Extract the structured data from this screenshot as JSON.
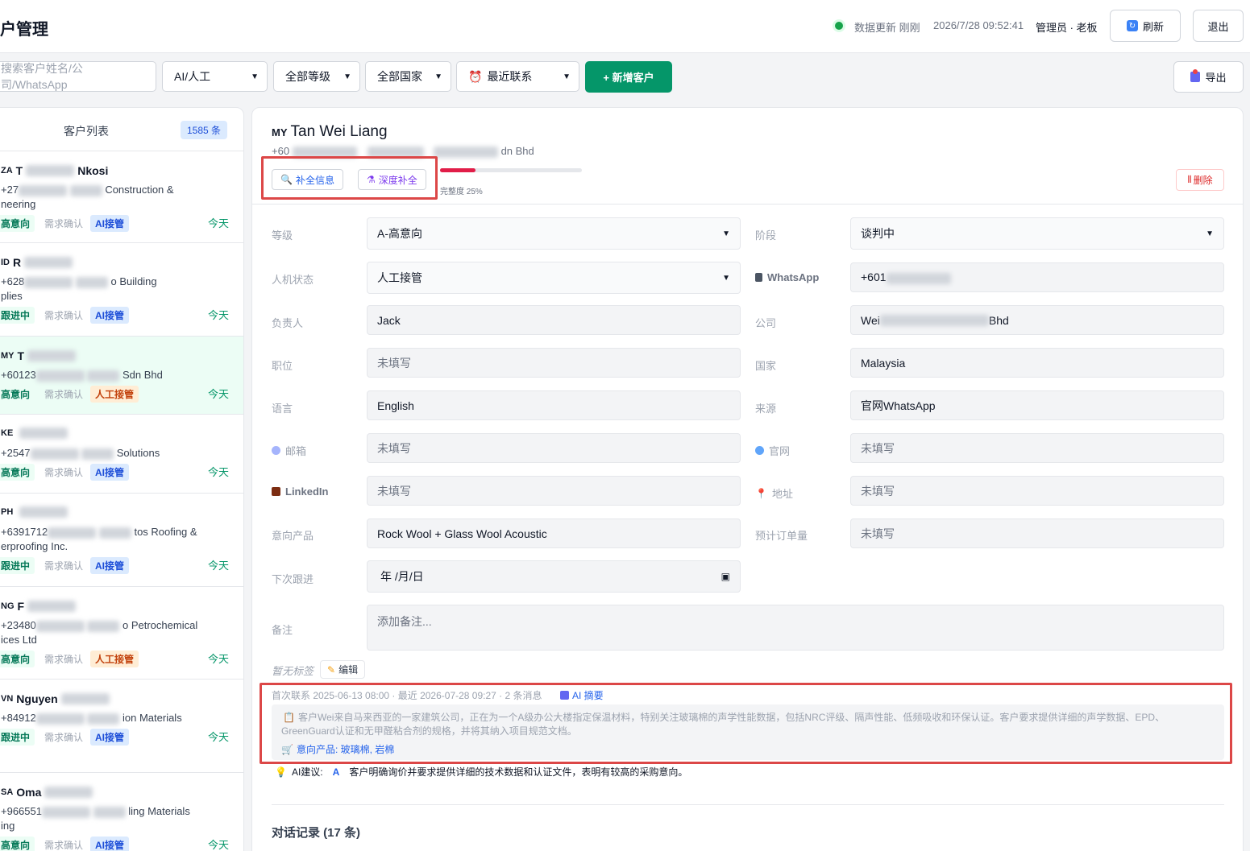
{
  "header": {
    "title": "户管理",
    "status_text": "数据更新 刚刚",
    "timestamp": "2026/7/28 09:52:41",
    "user": "管理员 · 老板",
    "refresh_label": "刷新",
    "logout_label": "退出"
  },
  "filters": {
    "search_placeholder": "搜索客户姓名/公司/WhatsApp",
    "ai_human": "AI/人工",
    "level": "全部等级",
    "country": "全部国家",
    "recent": "最近联系",
    "add_label": "+ 新增客户",
    "export_label": "导出"
  },
  "customer_list": {
    "title": "客户列表",
    "count": "1585 条",
    "items": [
      {
        "country": "ZA",
        "name": "T",
        "name2": "Nkosi",
        "line1a": "+27",
        "line1b": "Construction &",
        "line2": "neering",
        "stage": "高意向",
        "need": "需求确认",
        "mode": "AI接管",
        "mode_type": "ai",
        "time": "今天"
      },
      {
        "country": "ID",
        "name": "R",
        "name2": "",
        "line1a": "+628",
        "line1b": "o Building",
        "line2": "plies",
        "stage": "跟进中",
        "need": "需求确认",
        "mode": "AI接管",
        "mode_type": "ai",
        "time": "今天"
      },
      {
        "country": "MY",
        "name": "T",
        "name2": "",
        "line1a": "+60123",
        "line1b": "Sdn Bhd",
        "line2": "",
        "stage": "高意向",
        "need": "需求确认",
        "mode": "人工接管",
        "mode_type": "human",
        "time": "今天"
      },
      {
        "country": "KE",
        "name": "",
        "name2": "",
        "line1a": "+2547",
        "line1b": "Solutions",
        "line2": "",
        "stage": "高意向",
        "need": "需求确认",
        "mode": "AI接管",
        "mode_type": "ai",
        "time": "今天"
      },
      {
        "country": "PH",
        "name": "",
        "name2": "",
        "line1a": "+6391712",
        "line1b": "tos Roofing &",
        "line2": "erproofing Inc.",
        "stage": "跟进中",
        "need": "需求确认",
        "mode": "AI接管",
        "mode_type": "ai",
        "time": "今天"
      },
      {
        "country": "NG",
        "name": "F",
        "name2": "",
        "line1a": "+23480",
        "line1b": "o Petrochemical",
        "line2": "ices Ltd",
        "stage": "高意向",
        "need": "需求确认",
        "mode": "人工接管",
        "mode_type": "human",
        "time": "今天"
      },
      {
        "country": "VN",
        "name": "Nguyen",
        "name2": "",
        "line1a": "+84912",
        "line1b": "ion Materials",
        "line2": "",
        "stage": "跟进中",
        "need": "需求确认",
        "mode": "AI接管",
        "mode_type": "ai",
        "time": "今天"
      },
      {
        "country": "SA",
        "name": "Oma",
        "name2": "",
        "line1a": "+966551",
        "line1b": "ling Materials",
        "line2": "ing",
        "stage": "高意向",
        "need": "需求确认",
        "mode": "AI接管",
        "mode_type": "ai",
        "time": "今天"
      }
    ]
  },
  "detail": {
    "country": "MY",
    "name": "Tan Wei Liang",
    "phone_prefix": "+60",
    "company_suffix": "dn  Bhd",
    "fill_label": "补全信息",
    "deep_label": "深度补全",
    "completeness_label": "完整度 25%",
    "completeness": 0.25,
    "delete_label": "删除",
    "fields": {
      "level_label": "等级",
      "level": "A-高意向",
      "stage_label": "阶段",
      "stage": "谈判中",
      "mode_label": "人机状态",
      "mode": "人工接管",
      "whatsapp_label": "WhatsApp",
      "whatsapp": "+601",
      "owner_label": "负责人",
      "owner": "Jack",
      "company_label": "公司",
      "company_a": "Wei",
      "company_b": "Bhd",
      "position_label": "职位",
      "position": "未填写",
      "country_label": "国家",
      "country": "Malaysia",
      "language_label": "语言",
      "language": "English",
      "source_label": "来源",
      "source": "官网WhatsApp",
      "email_label": "邮箱",
      "email": "未填写",
      "website_label": "官网",
      "website": "未填写",
      "linkedin_label": "LinkedIn",
      "linkedin": "未填写",
      "address_label": "地址",
      "address": "未填写",
      "product_label": "意向产品",
      "product": "Rock Wool + Glass Wool Acoustic",
      "order_label": "预计订单量",
      "order": "未填写",
      "next_label": "下次跟进",
      "next": "年 /月/日",
      "memo_label": "备注",
      "memo_placeholder": "添加备注..."
    },
    "no_tags": "暂无标签",
    "edit_label": "编辑",
    "summary_meta": "首次联系 2025-06-13 08:00 · 最近 2026-07-28 09:27 · 2 条消息",
    "ai_summary_label": "AI 摘要",
    "summary_text": "客户Wei来自马来西亚的一家建筑公司，正在为一个A级办公大楼指定保温材料，特别关注玻璃棉的声学性能数据，包括NRC评级、隔声性能、低频吸收和环保认证。客户要求提供详细的声学数据、EPD、GreenGuard认证和无甲醛粘合剂的规格，并将其纳入项目规范文档。",
    "summary_products": "意向产品: 玻璃棉, 岩棉",
    "ai_suggest_label": "AI建议:",
    "ai_grade": "A",
    "ai_suggest_text": "客户明确询价并要求提供详细的技术数据和认证文件，表明有较高的采购意向。",
    "chat_title": "对话记录 (17 条)"
  }
}
